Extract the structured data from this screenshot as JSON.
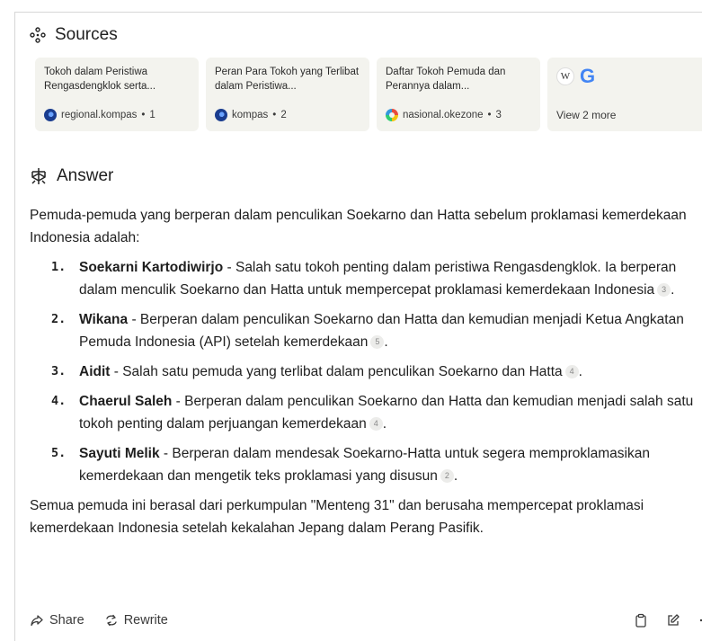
{
  "sources": {
    "heading": "Sources",
    "cards": [
      {
        "title": "Tokoh dalam Peristiwa Rengasdengklok serta...",
        "site": "regional.kompas",
        "index": "1",
        "favicon": "kompas-favicon"
      },
      {
        "title": "Peran Para Tokoh yang Terlibat dalam Peristiwa...",
        "site": "kompas",
        "index": "2",
        "favicon": "kompas-favicon"
      },
      {
        "title": "Daftar Tokoh Pemuda dan Perannya dalam...",
        "site": "nasional.okezone",
        "index": "3",
        "favicon": "okezone-favicon"
      }
    ],
    "more": {
      "label": "View 2 more",
      "wiki_letter": "W",
      "google_letter": "G"
    }
  },
  "answer": {
    "heading": "Answer",
    "intro": "Pemuda-pemuda yang berperan dalam penculikan Soekarno dan Hatta sebelum proklamasi kemerdekaan Indonesia adalah:",
    "items": [
      {
        "num": "1.",
        "name": "Soekarni Kartodiwirjo",
        "text": " - Salah satu tokoh penting dalam peristiwa Rengasdengklok. Ia berperan dalam menculik Soekarno dan Hatta untuk mempercepat proklamasi kemerdekaan Indonesia",
        "cite": "3",
        "end": "."
      },
      {
        "num": "2.",
        "name": "Wikana",
        "text": " - Berperan dalam penculikan Soekarno dan Hatta dan kemudian menjadi Ketua Angkatan Pemuda Indonesia (API) setelah kemerdekaan",
        "cite": "5",
        "end": "."
      },
      {
        "num": "3.",
        "name": "Aidit",
        "text": " - Salah satu pemuda yang terlibat dalam penculikan Soekarno dan Hatta",
        "cite": "4",
        "end": "."
      },
      {
        "num": "4.",
        "name": "Chaerul Saleh",
        "text": " - Berperan dalam penculikan Soekarno dan Hatta dan kemudian menjadi salah satu tokoh penting dalam perjuangan kemerdekaan",
        "cite": "4",
        "end": "."
      },
      {
        "num": "5.",
        "name": "Sayuti Melik",
        "text": " - Berperan dalam mendesak Soekarno-Hatta untuk segera memproklamasikan kemerdekaan dan mengetik teks proklamasi yang disusun",
        "cite": "2",
        "end": "."
      }
    ],
    "outro": "Semua pemuda ini berasal dari perkumpulan \"Menteng 31\" dan berusaha mempercepat proklamasi kemerdekaan Indonesia setelah kekalahan Jepang dalam Perang Pasifik."
  },
  "footer": {
    "share_label": "Share",
    "rewrite_label": "Rewrite",
    "icons": [
      "copy-icon",
      "edit-icon",
      "more-icon"
    ]
  },
  "colors": {
    "card_bg": "#f3f3ee",
    "text": "#1f1f1f",
    "cite_bg": "#ececea"
  }
}
